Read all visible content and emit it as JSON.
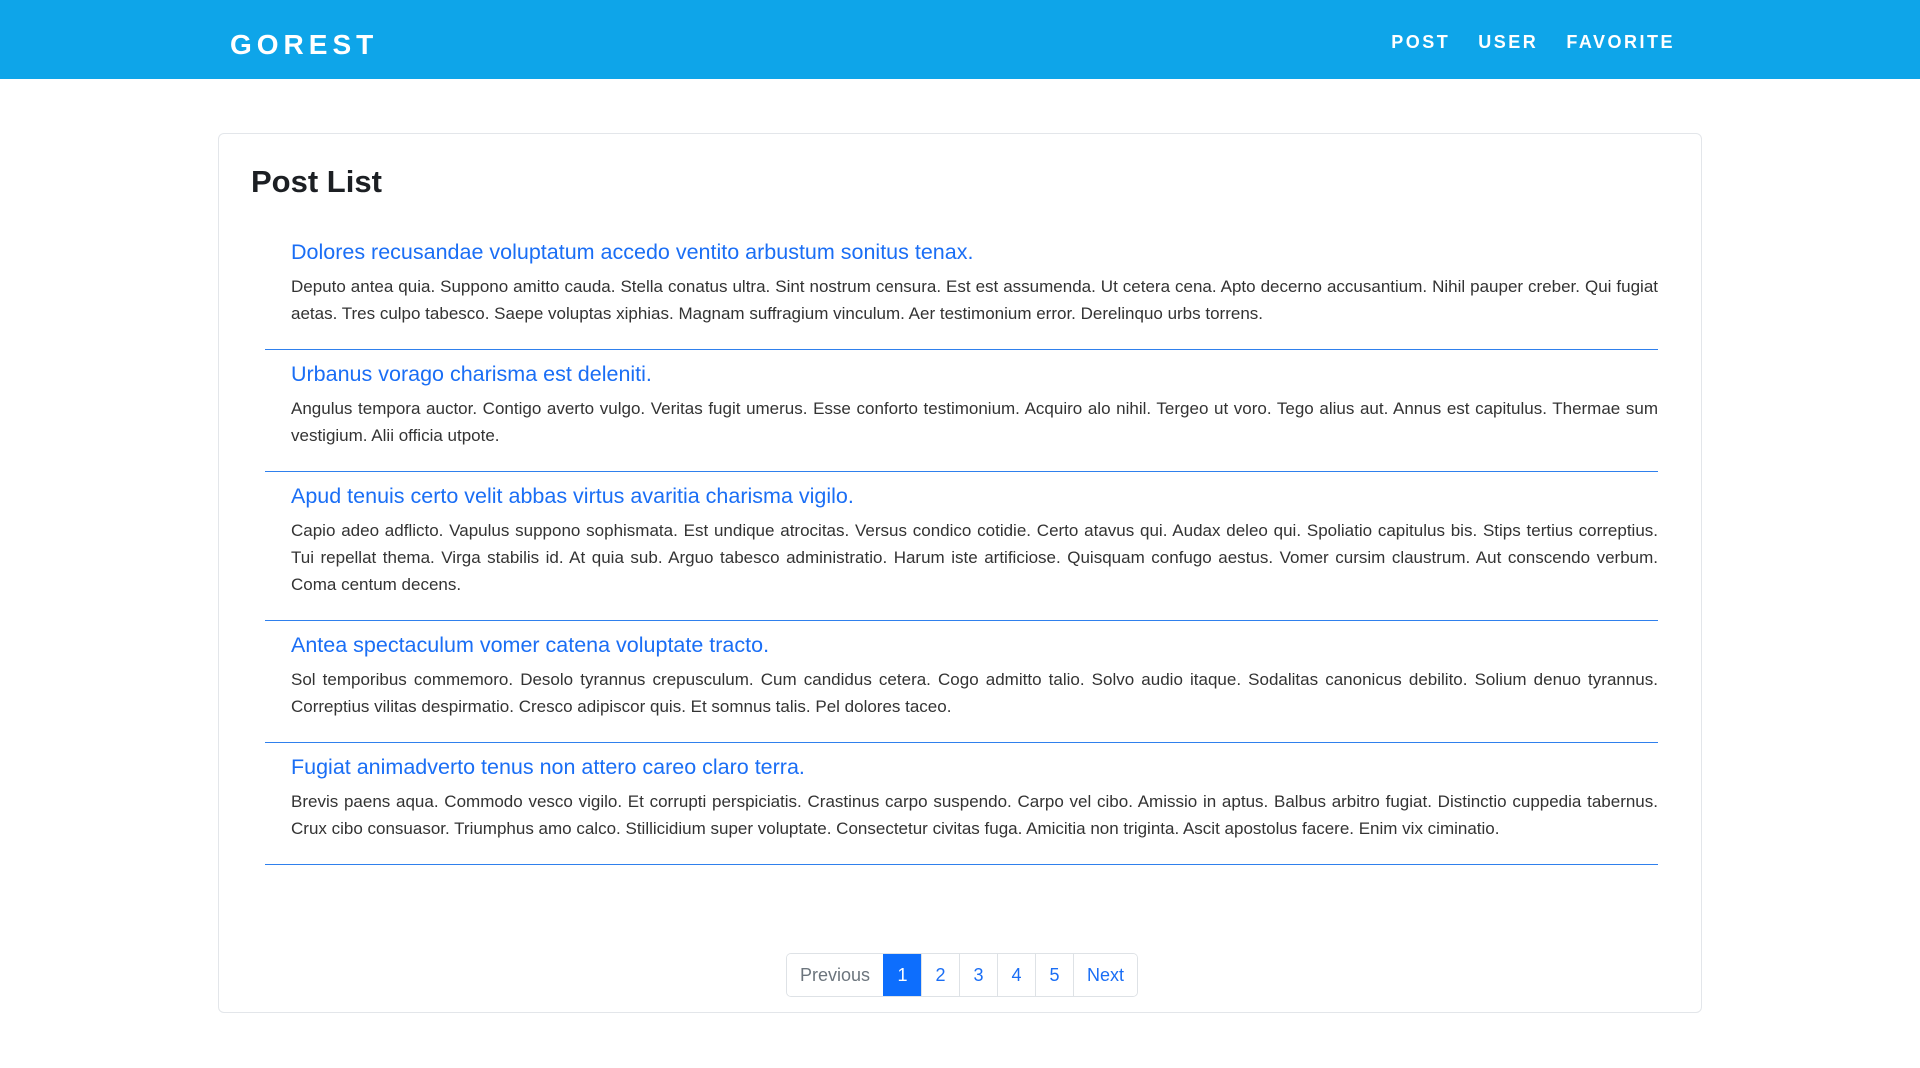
{
  "navbar": {
    "brand": "GOREST",
    "links": [
      "POST",
      "USER",
      "FAVORITE"
    ]
  },
  "main": {
    "title": "Post List",
    "posts": [
      {
        "title": "Dolores recusandae voluptatum accedo ventito arbustum sonitus tenax.",
        "body": "Deputo antea quia. Suppono amitto cauda. Stella conatus ultra. Sint nostrum censura. Est est assumenda. Ut cetera cena. Apto decerno accusantium. Nihil pauper creber. Qui fugiat aetas. Tres culpo tabesco. Saepe voluptas xiphias. Magnam suffragium vinculum. Aer testimonium error. Derelinquo urbs torrens."
      },
      {
        "title": "Urbanus vorago charisma est deleniti.",
        "body": "Angulus tempora auctor. Contigo averto vulgo. Veritas fugit umerus. Esse conforto testimonium. Acquiro alo nihil. Tergeo ut voro. Tego alius aut. Annus est capitulus. Thermae sum vestigium. Alii officia utpote."
      },
      {
        "title": "Apud tenuis certo velit abbas virtus avaritia charisma vigilo.",
        "body": "Capio adeo adflicto. Vapulus suppono sophismata. Est undique atrocitas. Versus condico cotidie. Certo atavus qui. Audax deleo qui. Spoliatio capitulus bis. Stips tertius correptius. Tui repellat thema. Virga stabilis id. At quia sub. Arguo tabesco administratio. Harum iste artificiose. Quisquam confugo aestus. Vomer cursim claustrum. Aut conscendo verbum. Coma centum decens."
      },
      {
        "title": "Antea spectaculum vomer catena voluptate tracto.",
        "body": "Sol temporibus commemoro. Desolo tyrannus crepusculum. Cum candidus cetera. Cogo admitto talio. Solvo audio itaque. Sodalitas canonicus debilito. Solium denuo tyrannus. Correptius vilitas despirmatio. Cresco adipiscor quis. Et somnus talis. Pel dolores taceo."
      },
      {
        "title": "Fugiat animadverto tenus non attero careo claro terra.",
        "body": "Brevis paens aqua. Commodo vesco vigilo. Et corrupti perspiciatis. Crastinus carpo suspendo. Carpo vel cibo. Amissio in aptus. Balbus arbitro fugiat. Distinctio cuppedia tabernus. Crux cibo consuasor. Triumphus amo calco. Stillicidium super voluptate. Consectetur civitas fuga. Amicitia non triginta. Ascit apostolus facere. Enim vix ciminatio."
      }
    ]
  },
  "pagination": {
    "previous": "Previous",
    "pages": [
      "1",
      "2",
      "3",
      "4",
      "5"
    ],
    "next": "Next",
    "current": "1"
  },
  "colors": {
    "navbar": "#0ea5e9",
    "link": "#1a6ef5",
    "active_page": "#0d6efd",
    "divider": "#2f80ed"
  }
}
